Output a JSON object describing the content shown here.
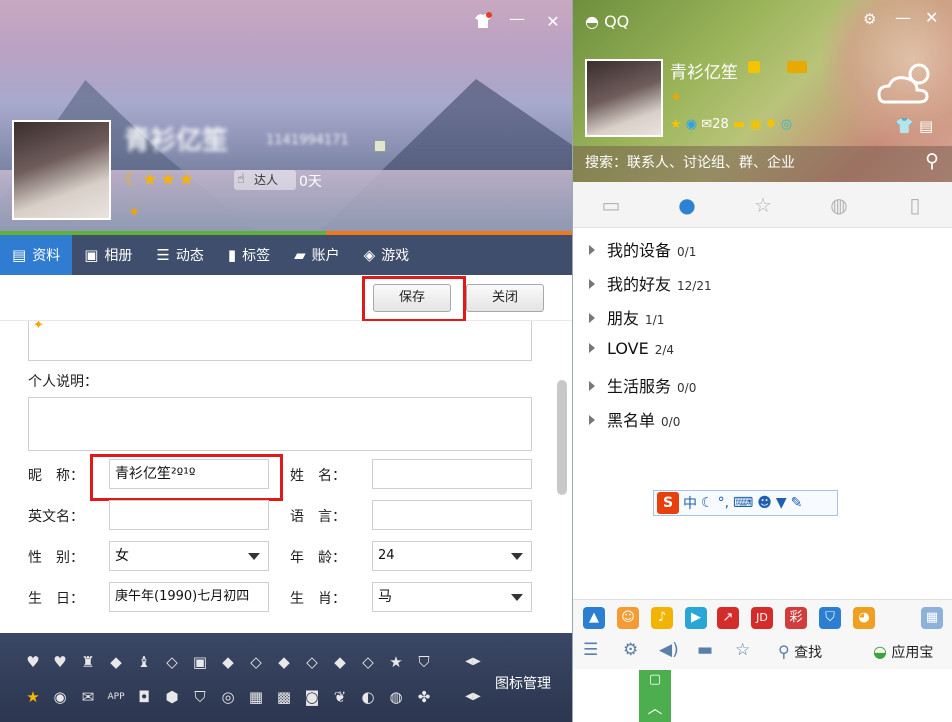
{
  "profile": {
    "nickname_blurred": "青衫亿笙",
    "qq_number_blurred": "1141994171",
    "days": "0天",
    "badge_label": "达人",
    "tabs": [
      {
        "label": "资料",
        "icon": "id-card-icon"
      },
      {
        "label": "相册",
        "icon": "photo-icon"
      },
      {
        "label": "动态",
        "icon": "list-icon"
      },
      {
        "label": "标签",
        "icon": "bookmark-icon"
      },
      {
        "label": "账户",
        "icon": "briefcase-icon"
      },
      {
        "label": "游戏",
        "icon": "game-icon"
      }
    ],
    "save_label": "保存",
    "close_label": "关闭",
    "progress_fraction": 0.57
  },
  "form": {
    "personal_desc_label": "个人说明：",
    "nickname_label": "昵　称：",
    "nickname_value": "青衫亿笙²º¹º",
    "surname_label": "姓　名：",
    "surname_value": "",
    "english_name_label": "英文名：",
    "english_name_value": "",
    "language_label": "语　言：",
    "language_value": "",
    "gender_label": "性　别：",
    "gender_value": "女",
    "age_label": "年　龄：",
    "age_value": "24",
    "birthday_label": "生　日：",
    "birthday_value": "庚午年(1990)七月初四",
    "zodiac_label": "生　肖：",
    "zodiac_value": "马"
  },
  "icon_panel": {
    "manage_label": "图标管理"
  },
  "qq": {
    "app_name": "QQ",
    "nickname": "青衫亿笙",
    "mail_count": "28",
    "search_placeholder": "搜索：联系人、讨论组、群、企业",
    "groups": [
      {
        "name": "我的设备",
        "count": "0/1"
      },
      {
        "name": "我的好友",
        "count": "12/21"
      },
      {
        "name": "朋友",
        "count": "1/1"
      },
      {
        "name": "LOVE",
        "count": "2/4"
      },
      {
        "name": "生活服务",
        "count": "0/0"
      },
      {
        "name": "黑名单",
        "count": "0/0"
      }
    ],
    "ime_chars": "中",
    "find_label": "查找",
    "app_store_label": "应用宝"
  }
}
